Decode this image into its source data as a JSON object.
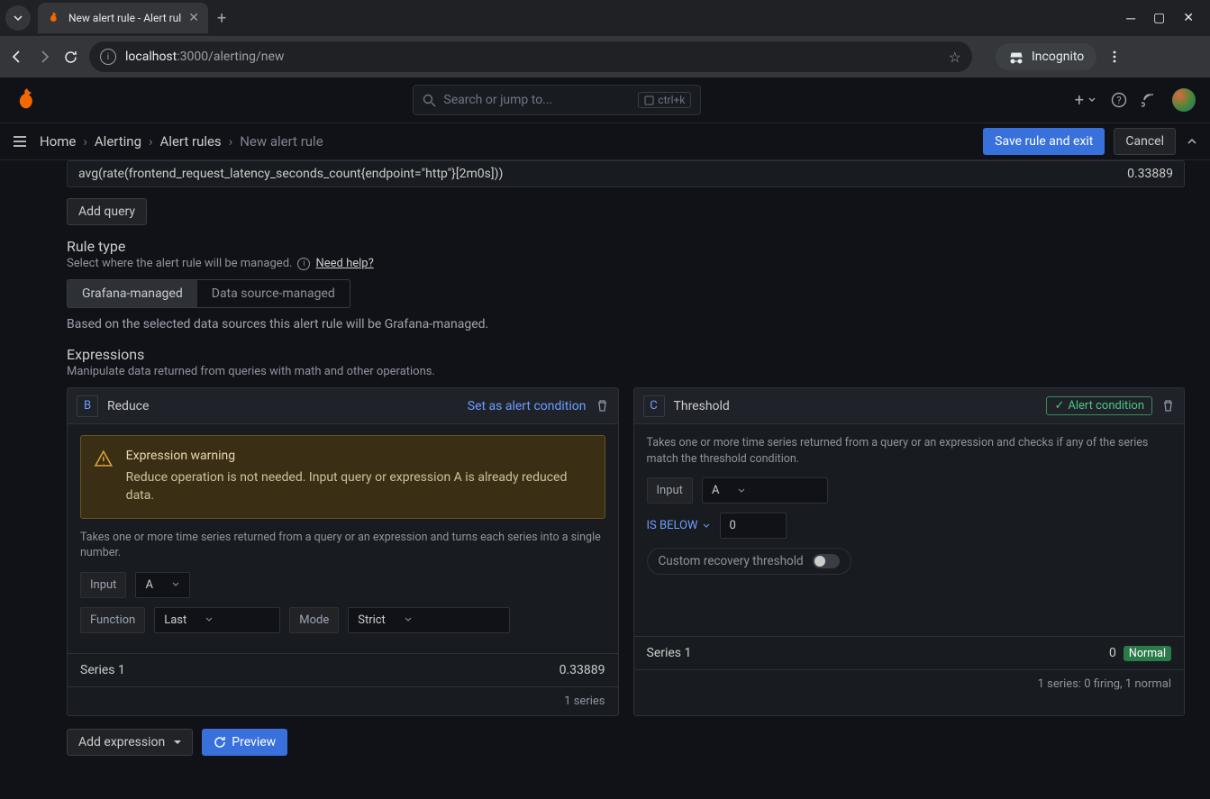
{
  "browser": {
    "tab_title": "New alert rule - Alert rul",
    "url_host": "localhost",
    "url_path": ":3000/alerting/new",
    "incognito": "Incognito"
  },
  "header": {
    "search_placeholder": "Search or jump to...",
    "search_shortcut": "ctrl+k"
  },
  "breadcrumbs": {
    "items": [
      "Home",
      "Alerting",
      "Alert rules"
    ],
    "current": "New alert rule",
    "save": "Save rule and exit",
    "cancel": "Cancel"
  },
  "query": {
    "text": "avg(rate(frontend_request_latency_seconds_count{endpoint=\"http\"}[2m0s]))",
    "value": "0.33889",
    "add_query": "Add query"
  },
  "rule_type": {
    "title": "Rule type",
    "subtitle": "Select where the alert rule will be managed.",
    "help": "Need help?",
    "options": [
      "Grafana-managed",
      "Data source-managed"
    ],
    "hint": "Based on the selected data sources this alert rule will be Grafana-managed."
  },
  "expressions": {
    "title": "Expressions",
    "subtitle": "Manipulate data returned from queries with math and other operations."
  },
  "reduce": {
    "ref": "B",
    "title": "Reduce",
    "set_condition": "Set as alert condition",
    "warning_title": "Expression warning",
    "warning_text": "Reduce operation is not needed. Input query or expression A is already reduced data.",
    "desc": "Takes one or more time series returned from a query or an expression and turns each series into a single number.",
    "input_label": "Input",
    "input_value": "A",
    "function_label": "Function",
    "function_value": "Last",
    "mode_label": "Mode",
    "mode_value": "Strict",
    "series_name": "Series 1",
    "series_value": "0.33889",
    "summary": "1 series"
  },
  "threshold": {
    "ref": "C",
    "title": "Threshold",
    "condition_badge": "Alert condition",
    "desc": "Takes one or more time series returned from a query or an expression and checks if any of the series match the threshold condition.",
    "input_label": "Input",
    "input_value": "A",
    "operator": "IS BELOW",
    "value": "0",
    "recovery_label": "Custom recovery threshold",
    "series_name": "Series 1",
    "series_value": "0",
    "series_status": "Normal",
    "summary": "1 series: 0 firing, 1 normal"
  },
  "actions": {
    "add_expression": "Add expression",
    "preview": "Preview"
  }
}
